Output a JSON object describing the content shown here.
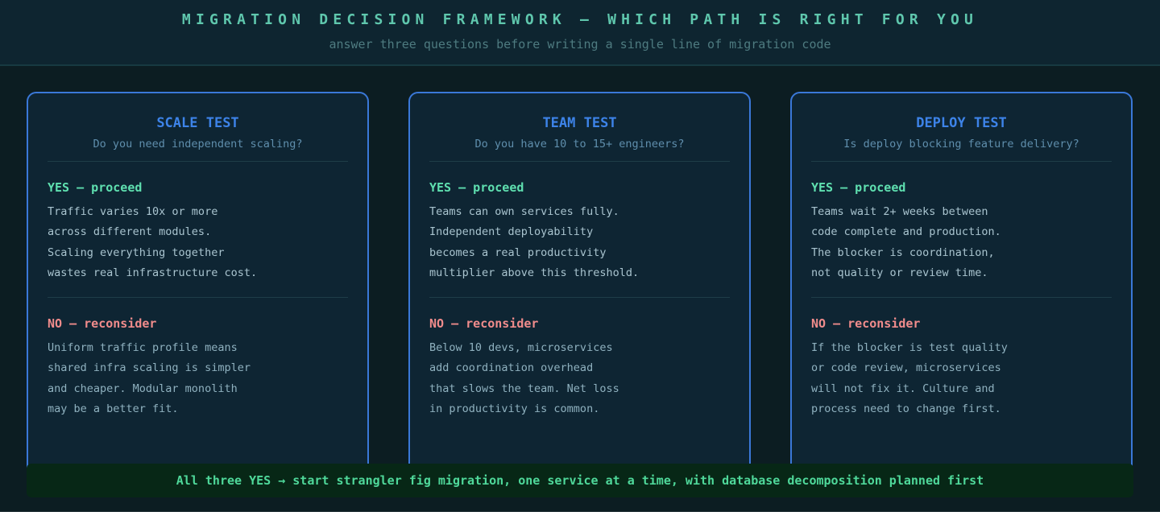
{
  "header": {
    "title": "MIGRATION DECISION FRAMEWORK — WHICH PATH IS RIGHT FOR YOU",
    "subtitle": "answer three questions before writing a single line of migration code"
  },
  "cards": [
    {
      "title": "SCALE TEST",
      "question": "Do you need independent scaling?",
      "yes_label": "YES — proceed",
      "yes_text": "Traffic varies 10x or more\nacross different modules.\nScaling everything together\nwastes real infrastructure cost.",
      "no_label": "NO — reconsider",
      "no_text": "Uniform traffic profile means\nshared infra scaling is simpler\nand cheaper. Modular monolith\nmay be a better fit."
    },
    {
      "title": "TEAM TEST",
      "question": "Do you have 10 to 15+ engineers?",
      "yes_label": "YES — proceed",
      "yes_text": "Teams can own services fully.\nIndependent deployability\nbecomes a real productivity\nmultiplier above this threshold.",
      "no_label": "NO — reconsider",
      "no_text": "Below 10 devs, microservices\nadd coordination overhead\nthat slows the team. Net loss\nin productivity is common."
    },
    {
      "title": "DEPLOY TEST",
      "question": "Is deploy blocking feature delivery?",
      "yes_label": "YES — proceed",
      "yes_text": "Teams wait 2+ weeks between\ncode complete and production.\nThe blocker is coordination,\nnot quality or review time.",
      "no_label": "NO — reconsider",
      "no_text": "If the blocker is test quality\nor code review, microservices\nwill not fix it. Culture and\nprocess need to change first."
    }
  ],
  "footer": {
    "text": "All three YES → start strangler fig migration, one service at a time, with database decomposition planned first"
  },
  "colors": {
    "accent_blue": "#3a78d8",
    "yes_green": "#5fe0b0",
    "no_red": "#f08c8c",
    "title_teal": "#5fc7ad"
  }
}
